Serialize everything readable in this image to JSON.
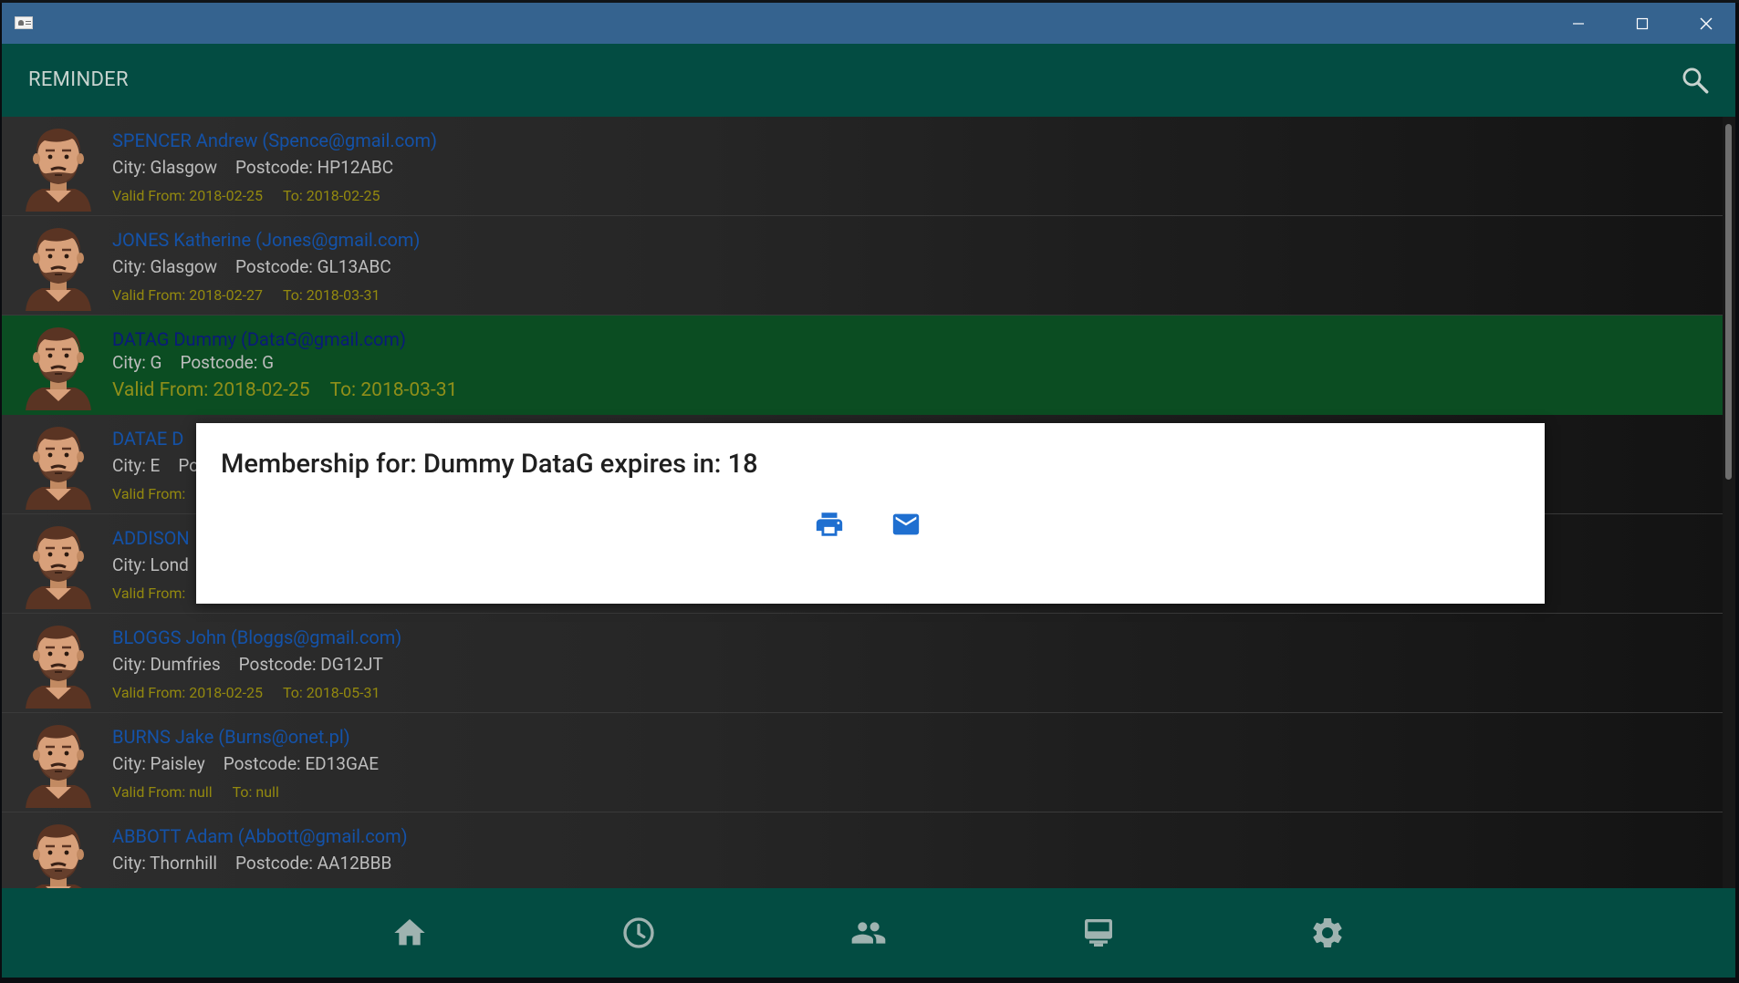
{
  "app": {
    "title": "REMINDER"
  },
  "colors": {
    "titlebar": "#35638f",
    "appbar": "#034c42",
    "selected_row": "#0b4d22",
    "name_link": "#1452a8",
    "validity_text": "#93890f",
    "icon_blue": "#1f6fd0"
  },
  "icons": {
    "app": "contact-card-icon",
    "search": "search-icon",
    "minimize": "minimize-icon",
    "maximize": "maximize-icon",
    "close": "close-icon",
    "print": "printer-icon",
    "email": "envelope-icon"
  },
  "labels": {
    "city": "City:",
    "postcode": "Postcode:",
    "valid_from": "Valid From:",
    "to": "To:"
  },
  "members": [
    {
      "name": "SPENCER Andrew (Spence@gmail.com)",
      "city": "Glasgow",
      "postcode": "HP12ABC",
      "valid_from": "2018-02-25",
      "valid_to": "2018-02-25",
      "selected": false
    },
    {
      "name": "JONES Katherine (Jones@gmail.com)",
      "city": "Glasgow",
      "postcode": "GL13ABC",
      "valid_from": "2018-02-27",
      "valid_to": "2018-03-31",
      "selected": false
    },
    {
      "name": "DATAG Dummy (DataG@gmail.com)",
      "city": "G",
      "postcode": "G",
      "valid_from": "2018-02-25",
      "valid_to": "2018-03-31",
      "selected": true
    },
    {
      "name": "DATAE D",
      "city": "E",
      "postcode": "",
      "valid_from": "",
      "valid_to": "",
      "selected": false,
      "partially_hidden": true
    },
    {
      "name": "ADDISON",
      "city": "Lond",
      "postcode": "",
      "valid_from": "",
      "valid_to": "",
      "selected": false,
      "partially_hidden": true
    },
    {
      "name": "BLOGGS John (Bloggs@gmail.com)",
      "city": "Dumfries",
      "postcode": "DG12JT",
      "valid_from": "2018-02-25",
      "valid_to": "2018-05-31",
      "selected": false
    },
    {
      "name": "BURNS Jake (Burns@onet.pl)",
      "city": "Paisley",
      "postcode": "ED13GAE",
      "valid_from": "null",
      "valid_to": "null",
      "selected": false
    },
    {
      "name": "ABBOTT Adam (Abbott@gmail.com)",
      "city": "Thornhill",
      "postcode": "AA12BBB",
      "valid_from": "",
      "valid_to": "",
      "selected": false
    }
  ],
  "dialog": {
    "message": "Membership for: Dummy DataG expires in: 18",
    "actions": [
      "print",
      "email"
    ]
  },
  "bottom_nav": [
    {
      "id": "home",
      "icon": "home-icon"
    },
    {
      "id": "reminder",
      "icon": "clock-icon",
      "active": true
    },
    {
      "id": "members",
      "icon": "people-icon"
    },
    {
      "id": "payments",
      "icon": "card-terminal-icon"
    },
    {
      "id": "settings",
      "icon": "gear-icon"
    }
  ]
}
